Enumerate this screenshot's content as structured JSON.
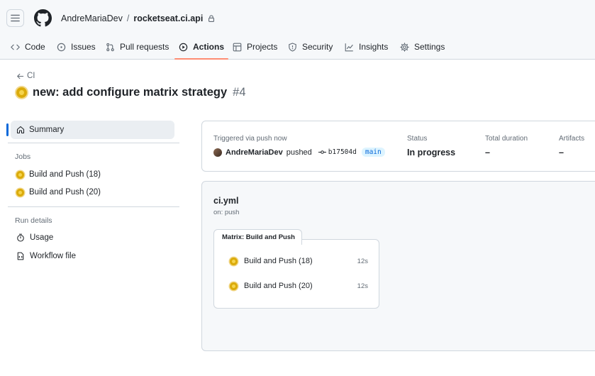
{
  "header": {
    "owner": "AndreMariaDev",
    "separator": "/",
    "repo": "rocketseat.ci.api"
  },
  "tabs": [
    {
      "label": "Code",
      "icon": "code-icon"
    },
    {
      "label": "Issues",
      "icon": "issue-icon"
    },
    {
      "label": "Pull requests",
      "icon": "pull-request-icon"
    },
    {
      "label": "Actions",
      "icon": "play-icon",
      "active": true
    },
    {
      "label": "Projects",
      "icon": "table-icon"
    },
    {
      "label": "Security",
      "icon": "shield-icon"
    },
    {
      "label": "Insights",
      "icon": "graph-icon"
    },
    {
      "label": "Settings",
      "icon": "gear-icon"
    }
  ],
  "back_link": "CI",
  "run": {
    "title": "new: add configure matrix strategy",
    "number": "#4"
  },
  "sidebar": {
    "summary": "Summary",
    "jobs_heading": "Jobs",
    "jobs": [
      "Build and Push (18)",
      "Build and Push (20)"
    ],
    "run_details_heading": "Run details",
    "usage": "Usage",
    "workflow_file": "Workflow file"
  },
  "summary": {
    "triggered": "Triggered via push now",
    "actor": "AndreMariaDev",
    "verb": "pushed",
    "commit": "b17504d",
    "branch": "main",
    "status_label": "Status",
    "status_value": "In progress",
    "duration_label": "Total duration",
    "duration_value": "–",
    "artifacts_label": "Artifacts",
    "artifacts_value": "–"
  },
  "workflow": {
    "file": "ci.yml",
    "trigger": "on: push",
    "matrix_label": "Matrix: Build and Push",
    "jobs": [
      {
        "name": "Build and Push (18)",
        "duration": "12s"
      },
      {
        "name": "Build and Push (20)",
        "duration": "12s"
      }
    ]
  },
  "colors": {
    "accent_underline": "#fd8c73",
    "in_progress": "#dbab0a",
    "link_blue": "#0969da"
  }
}
